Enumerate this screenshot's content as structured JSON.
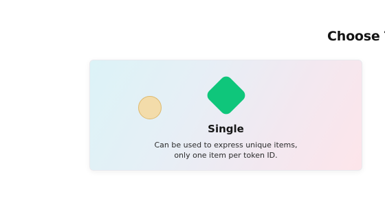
{
  "section": {
    "heading": "Choose T"
  },
  "card": {
    "title": "Single",
    "description_line1": "Can be used to express unique items,",
    "description_line2": "only one item per token ID.",
    "icon": "green-diamond-icon",
    "accent_color": "#0fc67b"
  },
  "cursor": {
    "icon": "cursor-circle-icon",
    "color": "#f3dcaa"
  }
}
